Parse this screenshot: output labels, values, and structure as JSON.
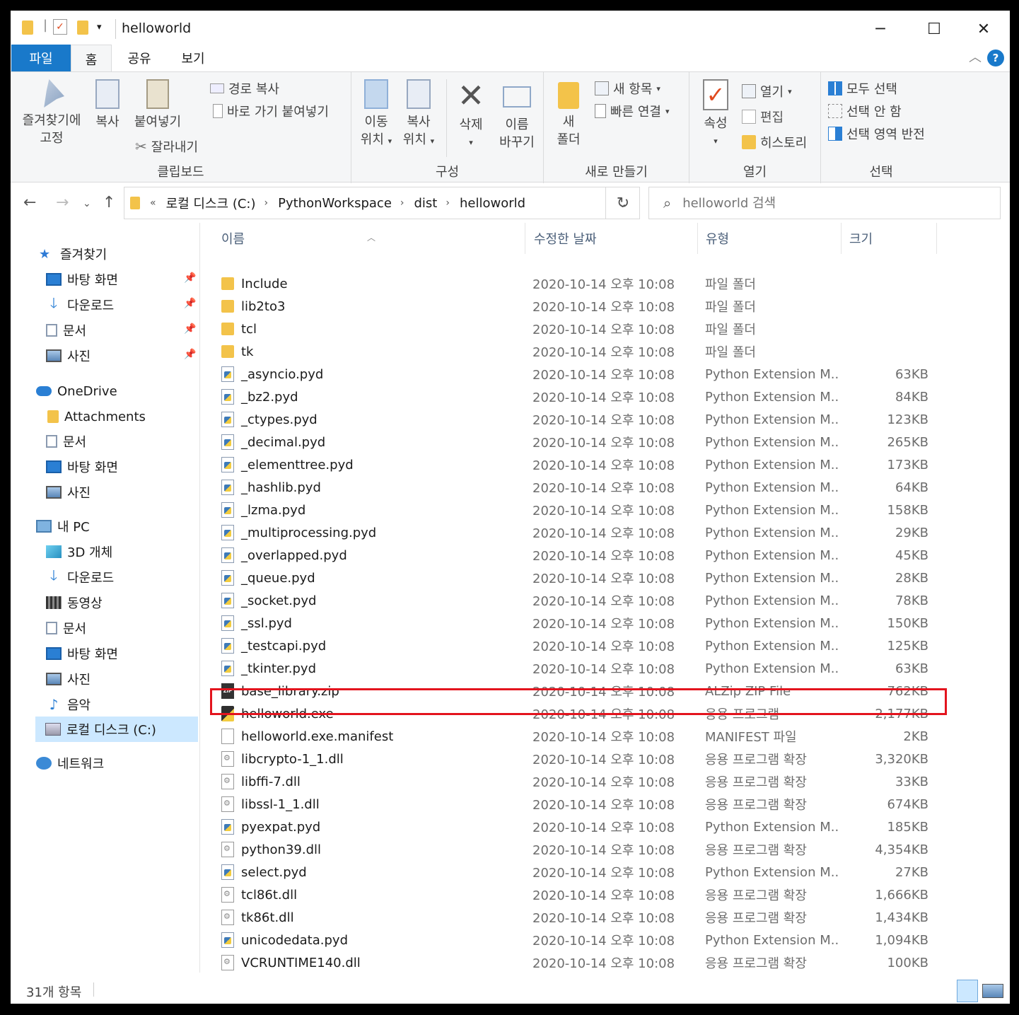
{
  "window": {
    "title": "helloworld",
    "minimize": "─",
    "maximize": "☐",
    "close": "✕"
  },
  "ribbon_tabs": [
    "파일",
    "홈",
    "공유",
    "보기"
  ],
  "help_label": "?",
  "ribbon": {
    "clipboard": {
      "label": "클립보드",
      "pin_label_1": "즐겨찾기에",
      "pin_label_2": "고정",
      "copy": "복사",
      "paste": "붙여넣기",
      "copy_path": "경로 복사",
      "paste_shortcut": "바로 가기 붙여넣기",
      "cut": "잘라내기"
    },
    "organize": {
      "label": "구성",
      "move_1": "이동",
      "move_2": "위치",
      "copy_1": "복사",
      "copy_2": "위치",
      "delete": "삭제",
      "rename_1": "이름",
      "rename_2": "바꾸기"
    },
    "new": {
      "label": "새로 만들기",
      "folder_1": "새",
      "folder_2": "폴더",
      "new_item": "새 항목",
      "easy_access": "빠른 연결"
    },
    "open": {
      "label": "열기",
      "properties": "속성",
      "open": "열기",
      "edit": "편집",
      "history": "히스토리"
    },
    "select": {
      "label": "선택",
      "select_all": "모두 선택",
      "select_none": "선택 안 함",
      "invert": "선택 영역 반전"
    }
  },
  "address": {
    "overflow": "«",
    "crumbs": [
      "로컬 디스크 (C:)",
      "PythonWorkspace",
      "dist",
      "helloworld"
    ],
    "search_placeholder": "helloworld 검색"
  },
  "nav": {
    "quick_access": "즐겨찾기",
    "desktop": "바탕 화면",
    "downloads": "다운로드",
    "documents": "문서",
    "pictures": "사진",
    "onedrive": "OneDrive",
    "attachments": "Attachments",
    "od_documents": "문서",
    "od_desktop": "바탕 화면",
    "od_pictures": "사진",
    "this_pc": "내 PC",
    "objects3d": "3D 개체",
    "pc_downloads": "다운로드",
    "videos": "동영상",
    "pc_documents": "문서",
    "pc_desktop": "바탕 화면",
    "pc_pictures": "사진",
    "music": "음악",
    "local_disk": "로컬 디스크 (C:)",
    "network": "네트워크"
  },
  "columns": {
    "name": "이름",
    "date": "수정한 날짜",
    "type": "유형",
    "size": "크기"
  },
  "files": [
    {
      "name": "Include",
      "date": "2020-10-14 오후 10:08",
      "type": "파일 폴더",
      "size": "",
      "icon": "folder"
    },
    {
      "name": "lib2to3",
      "date": "2020-10-14 오후 10:08",
      "type": "파일 폴더",
      "size": "",
      "icon": "folder"
    },
    {
      "name": "tcl",
      "date": "2020-10-14 오후 10:08",
      "type": "파일 폴더",
      "size": "",
      "icon": "folder"
    },
    {
      "name": "tk",
      "date": "2020-10-14 오후 10:08",
      "type": "파일 폴더",
      "size": "",
      "icon": "folder"
    },
    {
      "name": "_asyncio.pyd",
      "date": "2020-10-14 오후 10:08",
      "type": "Python Extension M...",
      "size": "63KB",
      "icon": "pyd"
    },
    {
      "name": "_bz2.pyd",
      "date": "2020-10-14 오후 10:08",
      "type": "Python Extension M...",
      "size": "84KB",
      "icon": "pyd"
    },
    {
      "name": "_ctypes.pyd",
      "date": "2020-10-14 오후 10:08",
      "type": "Python Extension M...",
      "size": "123KB",
      "icon": "pyd"
    },
    {
      "name": "_decimal.pyd",
      "date": "2020-10-14 오후 10:08",
      "type": "Python Extension M...",
      "size": "265KB",
      "icon": "pyd"
    },
    {
      "name": "_elementtree.pyd",
      "date": "2020-10-14 오후 10:08",
      "type": "Python Extension M...",
      "size": "173KB",
      "icon": "pyd"
    },
    {
      "name": "_hashlib.pyd",
      "date": "2020-10-14 오후 10:08",
      "type": "Python Extension M...",
      "size": "64KB",
      "icon": "pyd"
    },
    {
      "name": "_lzma.pyd",
      "date": "2020-10-14 오후 10:08",
      "type": "Python Extension M...",
      "size": "158KB",
      "icon": "pyd"
    },
    {
      "name": "_multiprocessing.pyd",
      "date": "2020-10-14 오후 10:08",
      "type": "Python Extension M...",
      "size": "29KB",
      "icon": "pyd"
    },
    {
      "name": "_overlapped.pyd",
      "date": "2020-10-14 오후 10:08",
      "type": "Python Extension M...",
      "size": "45KB",
      "icon": "pyd"
    },
    {
      "name": "_queue.pyd",
      "date": "2020-10-14 오후 10:08",
      "type": "Python Extension M...",
      "size": "28KB",
      "icon": "pyd"
    },
    {
      "name": "_socket.pyd",
      "date": "2020-10-14 오후 10:08",
      "type": "Python Extension M...",
      "size": "78KB",
      "icon": "pyd"
    },
    {
      "name": "_ssl.pyd",
      "date": "2020-10-14 오후 10:08",
      "type": "Python Extension M...",
      "size": "150KB",
      "icon": "pyd"
    },
    {
      "name": "_testcapi.pyd",
      "date": "2020-10-14 오후 10:08",
      "type": "Python Extension M...",
      "size": "125KB",
      "icon": "pyd"
    },
    {
      "name": "_tkinter.pyd",
      "date": "2020-10-14 오후 10:08",
      "type": "Python Extension M...",
      "size": "63KB",
      "icon": "pyd"
    },
    {
      "name": "base_library.zip",
      "date": "2020-10-14 오후 10:08",
      "type": "ALZip ZIP File",
      "size": "762KB",
      "icon": "zip"
    },
    {
      "name": "helloworld.exe",
      "date": "2020-10-14 오후 10:08",
      "type": "응용 프로그램",
      "size": "2,177KB",
      "icon": "exe"
    },
    {
      "name": "helloworld.exe.manifest",
      "date": "2020-10-14 오후 10:08",
      "type": "MANIFEST 파일",
      "size": "2KB",
      "icon": "blank"
    },
    {
      "name": "libcrypto-1_1.dll",
      "date": "2020-10-14 오후 10:08",
      "type": "응용 프로그램 확장",
      "size": "3,320KB",
      "icon": "dll"
    },
    {
      "name": "libffi-7.dll",
      "date": "2020-10-14 오후 10:08",
      "type": "응용 프로그램 확장",
      "size": "33KB",
      "icon": "dll"
    },
    {
      "name": "libssl-1_1.dll",
      "date": "2020-10-14 오후 10:08",
      "type": "응용 프로그램 확장",
      "size": "674KB",
      "icon": "dll"
    },
    {
      "name": "pyexpat.pyd",
      "date": "2020-10-14 오후 10:08",
      "type": "Python Extension M...",
      "size": "185KB",
      "icon": "pyd"
    },
    {
      "name": "python39.dll",
      "date": "2020-10-14 오후 10:08",
      "type": "응용 프로그램 확장",
      "size": "4,354KB",
      "icon": "dll"
    },
    {
      "name": "select.pyd",
      "date": "2020-10-14 오후 10:08",
      "type": "Python Extension M...",
      "size": "27KB",
      "icon": "pyd"
    },
    {
      "name": "tcl86t.dll",
      "date": "2020-10-14 오후 10:08",
      "type": "응용 프로그램 확장",
      "size": "1,666KB",
      "icon": "dll"
    },
    {
      "name": "tk86t.dll",
      "date": "2020-10-14 오후 10:08",
      "type": "응용 프로그램 확장",
      "size": "1,434KB",
      "icon": "dll"
    },
    {
      "name": "unicodedata.pyd",
      "date": "2020-10-14 오후 10:08",
      "type": "Python Extension M...",
      "size": "1,094KB",
      "icon": "pyd"
    },
    {
      "name": "VCRUNTIME140.dll",
      "date": "2020-10-14 오후 10:08",
      "type": "응용 프로그램 확장",
      "size": "100KB",
      "icon": "dll"
    }
  ],
  "status": {
    "count": "31개 항목"
  },
  "colors": {
    "accent": "#1979ca",
    "highlight_box": "#e3141e",
    "selected_nav": "#cce8ff"
  }
}
